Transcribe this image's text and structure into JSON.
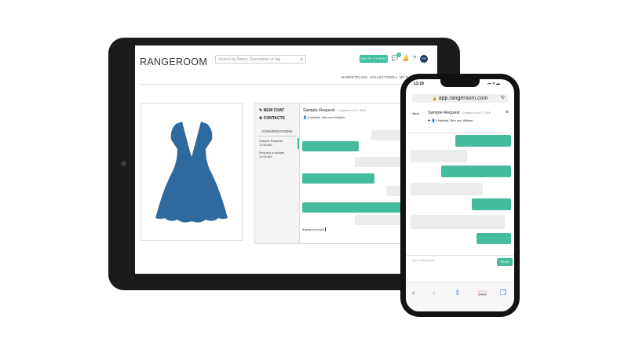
{
  "tablet": {
    "logo": "RANGEROOM",
    "search_placeholder": "Search by Name, Description or tag",
    "invite_label": "INVITE OTHERS",
    "notif_count": "1",
    "avatar_initials": "RR",
    "nav": [
      "MARKETPLACE",
      "COLLECTIONS ▾",
      "MY T"
    ],
    "sidebar": {
      "new_chat": "NEW CHAT",
      "contacts": "CONTACTS",
      "conversations_label": "CONVERSATIONS",
      "conversations": [
        {
          "title": "Sample Request",
          "time": "11:55 AM"
        },
        {
          "title": "Request a sample",
          "time": "11:54 AM"
        }
      ]
    },
    "chat": {
      "title": "Sample Request",
      "date": "· Created on Jul 2, 2018",
      "people_count": "3",
      "people": "Nabilah, Bea and William",
      "typed_text": "thanks so much"
    }
  },
  "phone": {
    "time": "13:19",
    "status": "▪▪▪ ᯤ ▬",
    "url": "app.rangeroom.com",
    "back_label": "Back",
    "title": "Sample Request",
    "date": "· Created on Jul 2, 2018",
    "people_count": "3",
    "people": "Nabilah, Bea and William",
    "input_placeholder": "Type a Message",
    "send_label": "SEND"
  },
  "colors": {
    "accent": "#46bc9e",
    "dress": "#2f6a9e",
    "device": "#1b1b1b"
  },
  "icons": [
    "search-icon",
    "chat-icon",
    "bell-icon",
    "help-icon",
    "edit-icon",
    "plus-icon",
    "person-icon",
    "lock-icon",
    "reload-icon",
    "close-icon",
    "share-icon",
    "book-icon",
    "tabs-icon"
  ]
}
